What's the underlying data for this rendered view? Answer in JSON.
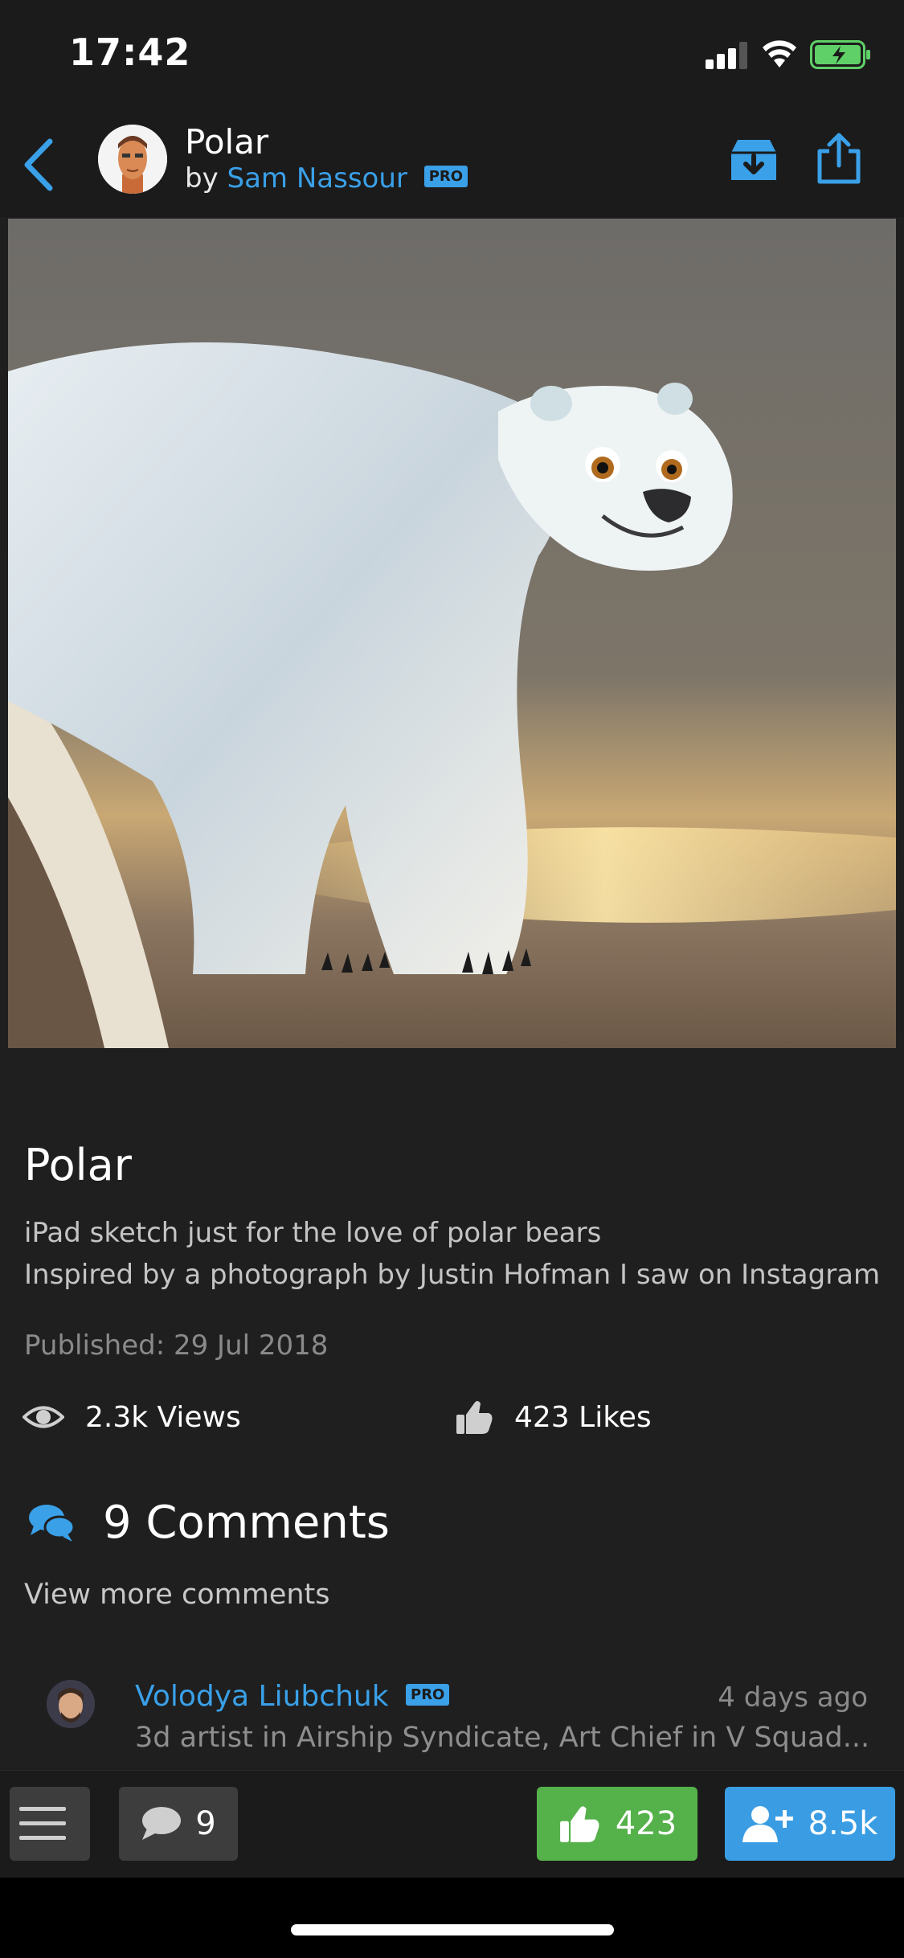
{
  "status": {
    "time": "17:42"
  },
  "header": {
    "title": "Polar",
    "by_prefix": "by",
    "author": "Sam Nassour",
    "pro_badge": "PRO"
  },
  "artwork": {
    "title": "Polar",
    "description_line1": "iPad sketch just for the love of polar bears",
    "description_line2": "Inspired by a photograph by Justin Hofman I saw on Instagram",
    "published": "Published: 29 Jul 2018",
    "views": "2.3k Views",
    "likes": "423 Likes"
  },
  "comments": {
    "heading": "9 Comments",
    "view_more": "View more comments",
    "items": [
      {
        "author": "Volodya Liubchuk",
        "pro_badge": "PRO",
        "time": "4 days ago",
        "text": "3d artist in Airship Syndicate, Art Chief in V Squad..."
      }
    ]
  },
  "bottom_bar": {
    "comment_count": "9",
    "like_count": "423",
    "follow_count": "8.5k"
  },
  "colors": {
    "accent_blue": "#3aa0e8",
    "like_green": "#55b14a",
    "follow_blue": "#3a9de3",
    "background": "#1f1f1f"
  },
  "icons": [
    "back-icon",
    "save-icon",
    "share-icon",
    "eye-icon",
    "thumbs-up-icon",
    "comments-icon",
    "menu-icon",
    "comment-bubble-icon",
    "add-user-icon"
  ]
}
